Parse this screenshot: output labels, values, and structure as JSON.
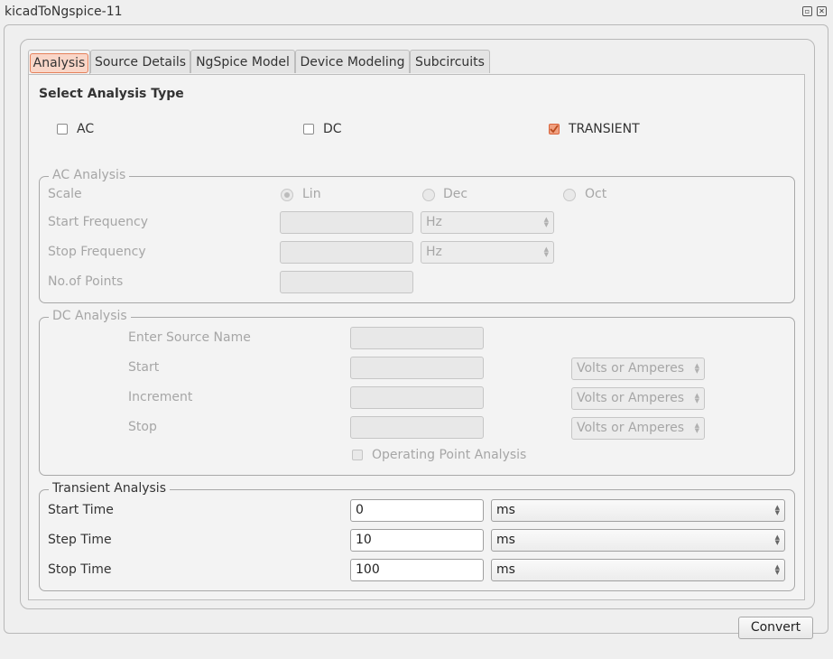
{
  "window": {
    "title": "kicadToNgspice-11",
    "restore_glyph": "▫",
    "close_glyph": "✕"
  },
  "tabs": [
    {
      "label": "Analysis",
      "active": true
    },
    {
      "label": "Source Details",
      "active": false
    },
    {
      "label": "NgSpice Model",
      "active": false
    },
    {
      "label": "Device Modeling",
      "active": false
    },
    {
      "label": "Subcircuits",
      "active": false
    }
  ],
  "analysis": {
    "heading": "Select Analysis Type",
    "types": [
      {
        "label": "AC",
        "checked": false
      },
      {
        "label": "DC",
        "checked": false
      },
      {
        "label": "TRANSIENT",
        "checked": true
      }
    ]
  },
  "ac": {
    "title": "AC Analysis",
    "scale_label": "Scale",
    "scale_options": [
      {
        "label": "Lin",
        "selected": true
      },
      {
        "label": "Dec",
        "selected": false
      },
      {
        "label": "Oct",
        "selected": false
      }
    ],
    "start_label": "Start Frequency",
    "start_value": "",
    "start_unit": "Hz",
    "stop_label": "Stop Frequency",
    "stop_value": "",
    "stop_unit": "Hz",
    "points_label": "No.of Points",
    "points_value": ""
  },
  "dc": {
    "title": "DC Analysis",
    "source_label": "Enter Source Name",
    "start_label": "Start",
    "increment_label": "Increment",
    "stop_label": "Stop",
    "unit": "Volts or Amperes",
    "op_label": "Operating Point Analysis",
    "op_checked": false
  },
  "transient": {
    "title": "Transient Analysis",
    "start_label": "Start Time",
    "start_value": "0",
    "start_unit": "ms",
    "step_label": "Step Time",
    "step_value": "10",
    "step_unit": "ms",
    "stop_label": "Stop Time",
    "stop_value": "100",
    "stop_unit": "ms"
  },
  "footer": {
    "convert_label": "Convert"
  },
  "colors": {
    "accent": "#e6805a",
    "accent_fill": "#f9d6c8",
    "window_bg": "#efefef"
  }
}
